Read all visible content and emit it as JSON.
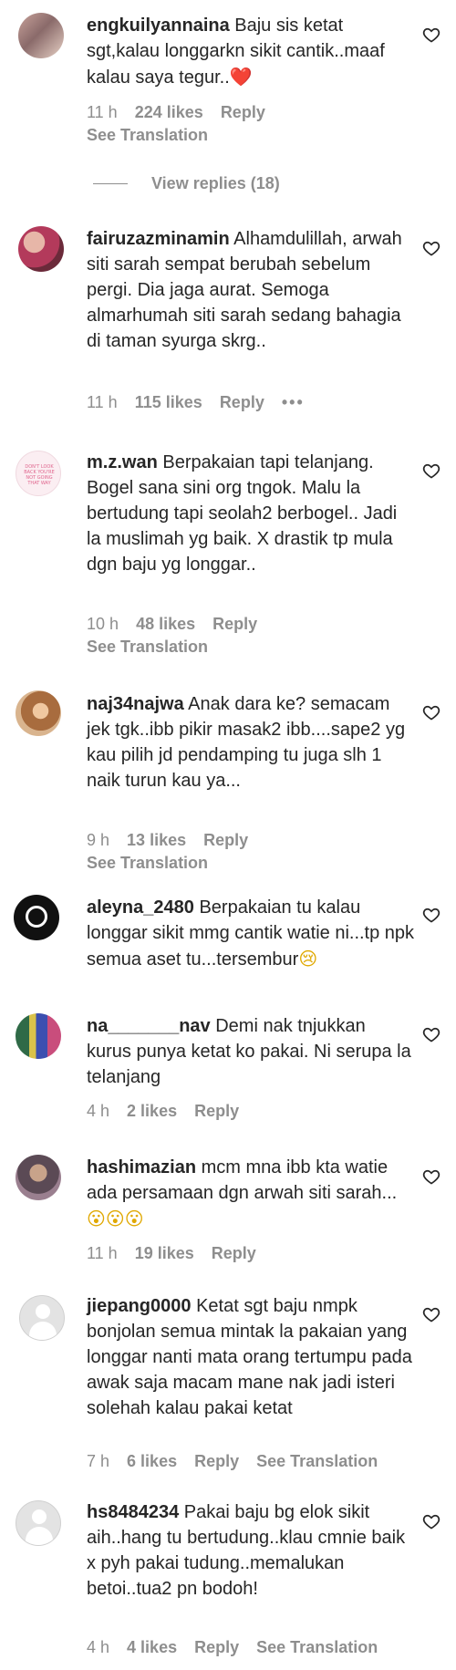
{
  "comments": [
    {
      "username": "engkuilyannaina",
      "text": " Baju sis ketat sgt,kalau longgarkn sikit cantik..maaf kalau saya tegur..",
      "emoji": "❤️",
      "time": "11 h",
      "likes": "224 likes",
      "reply": "Reply",
      "translation": "See Translation"
    },
    {
      "username": "fairuzazminamin",
      "text": " Alhamdulillah, arwah siti sarah sempat berubah sebelum pergi. Dia jaga aurat. Semoga almarhumah siti sarah sedang bahagia di taman syurga skrg..",
      "time": "11 h",
      "likes": "115 likes",
      "reply": "Reply",
      "more": "•••"
    },
    {
      "username": "m.z.wan",
      "text": " Berpakaian tapi telanjang. Bogel sana sini org tngok. Malu la bertudung tapi seolah2 berbogel.. Jadi la muslimah yg baik. X drastik tp mula dgn baju yg longgar..",
      "time": "10 h",
      "likes": "48 likes",
      "reply": "Reply",
      "translation": "See Translation"
    },
    {
      "username": "naj34najwa",
      "text": " Anak dara ke? semacam jek tgk..ibb pikir masak2 ibb....sape2 yg kau pilih jd pendamping tu juga slh 1 naik turun kau ya...",
      "time": "9 h",
      "likes": "13 likes",
      "reply": "Reply",
      "translation": "See Translation"
    },
    {
      "username": "aleyna_2480",
      "text": " Berpakaian tu kalau longgar sikit mmg cantik watie ni...tp npk semua aset tu...tersembur",
      "emoji": "😢"
    },
    {
      "username": "na_______nav",
      "text": " Demi nak tnjukkan kurus punya ketat ko pakai. Ni serupa la telanjang",
      "time": "4 h",
      "likes": "2 likes",
      "reply": "Reply"
    },
    {
      "username": "hashimazian",
      "text": " mcm mna ibb kta watie ada persamaan dgn arwah siti sarah...",
      "emoji": "😮😮😮",
      "time": "11 h",
      "likes": "19 likes",
      "reply": "Reply"
    },
    {
      "username": "jiepang0000",
      "text": " Ketat sgt baju nmpk bonjolan semua mintak la pakaian yang longgar nanti mata orang tertumpu pada awak saja macam mane nak jadi isteri solehah kalau pakai ketat",
      "time": "7 h",
      "likes": "6 likes",
      "reply": "Reply",
      "translation": "See Translation"
    },
    {
      "username": "hs8484234",
      "text": " Pakai baju bg elok sikit aih..hang tu bertudung..klau cmnie baik x pyh pakai tudung..memalukan betoi..tua2 pn bodoh!",
      "time": "4 h",
      "likes": "4 likes",
      "reply": "Reply",
      "translation": "See Translation"
    }
  ],
  "view_replies": "View replies (18)",
  "avatar_c_text": "DON'T LOOK BACK YOU'RE NOT GOING THAT WAY",
  "colors": {
    "text": "#262626",
    "muted": "#8e8e8e",
    "heart_red": "#ed4956"
  }
}
